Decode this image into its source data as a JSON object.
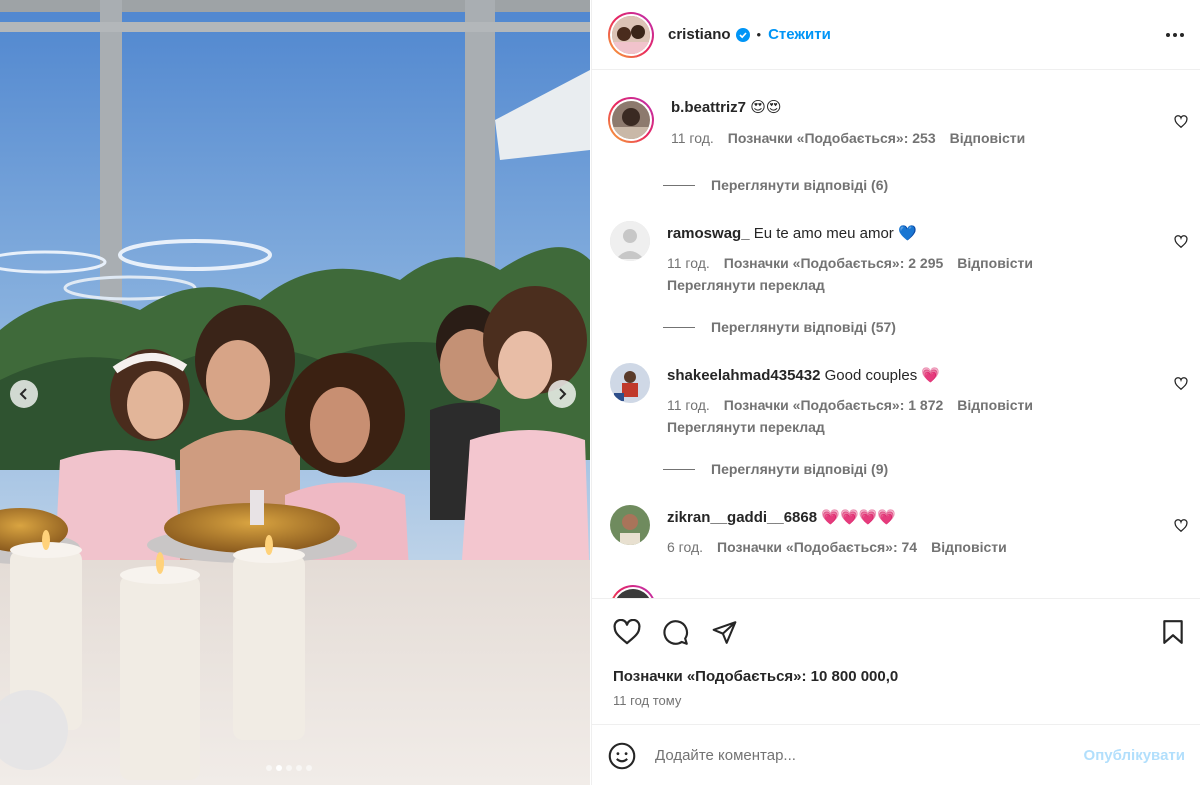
{
  "post": {
    "author": "cristiano",
    "follow_label": "Стежити",
    "separator": "•",
    "carousel_total_dots": 5,
    "carousel_active_dot": 2
  },
  "comments": [
    {
      "user": "b.beattriz7",
      "text": "",
      "emoji": [
        "😍",
        "😍"
      ],
      "time": "11 год.",
      "likes": "Позначки «Подобається»: 253",
      "reply": "Відповісти",
      "translation": "",
      "view_replies": "Переглянути відповіді (6)"
    },
    {
      "user": "ramoswag_",
      "text": "Eu te amo meu amor",
      "emoji": [
        "💙"
      ],
      "time": "11 год.",
      "likes": "Позначки «Подобається»: 2 295",
      "reply": "Відповісти",
      "translation": "Переглянути переклад",
      "view_replies": "Переглянути відповіді (57)"
    },
    {
      "user": "shakeelahmad435432",
      "text": "Good couples",
      "emoji": [
        "💗"
      ],
      "time": "11 год.",
      "likes": "Позначки «Подобається»: 1 872",
      "reply": "Відповісти",
      "translation": "Переглянути переклад",
      "view_replies": "Переглянути відповіді (9)"
    },
    {
      "user": "zikran__gaddi__6868",
      "text": "",
      "emoji": [
        "💗",
        "💗",
        "💗",
        "💗"
      ],
      "time": "6 год.",
      "likes": "Позначки «Подобається»: 74",
      "reply": "Відповісти",
      "translation": "",
      "view_replies": ""
    }
  ],
  "footer": {
    "likes": "Позначки «Подобається»: 10 800 000,0",
    "time_ago": "11 год тому",
    "comment_placeholder": "Додайте коментар...",
    "publish_label": "Опублікувати"
  },
  "colors": {
    "link": "#0095f6",
    "publish_disabled": "#b2dffc",
    "muted": "#737373",
    "text": "#262626"
  },
  "icons": [
    "chevron-left-icon",
    "chevron-right-icon",
    "verified-badge-icon",
    "more-options-icon",
    "heart-icon",
    "comment-icon",
    "share-icon",
    "bookmark-icon",
    "emoji-icon"
  ]
}
